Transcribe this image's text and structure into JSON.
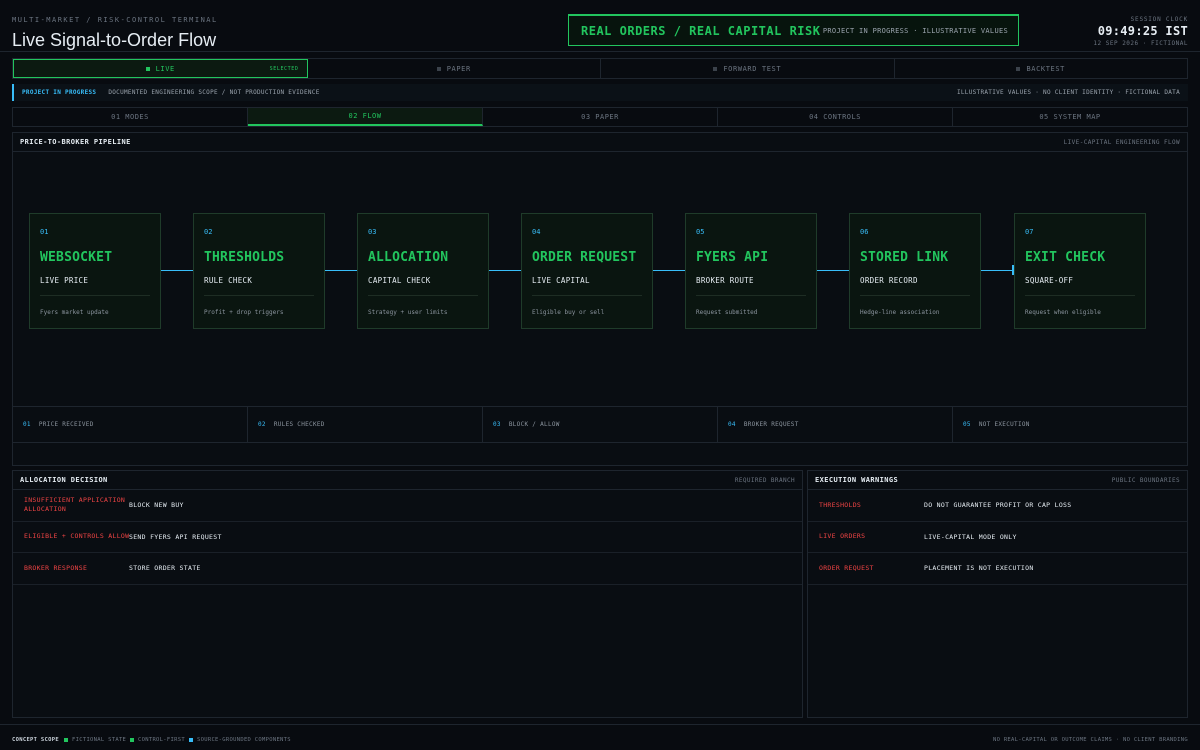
{
  "header": {
    "eyebrow": "MULTI-MARKET / RISK-CONTROL TERMINAL",
    "title": "Live Signal-to-Order Flow",
    "risk_banner": "REAL ORDERS / REAL CAPITAL RISK",
    "risk_sub": "PROJECT IN PROGRESS · ILLUSTRATIVE VALUES",
    "clock_label": "SESSION CLOCK",
    "clock": "09:49:25 IST",
    "clock_date": "12 SEP 2026 · FICTIONAL"
  },
  "modes": [
    {
      "label": "LIVE",
      "tag": "SELECTED",
      "active": true
    },
    {
      "label": "PAPER",
      "active": false
    },
    {
      "label": "FORWARD TEST",
      "active": false
    },
    {
      "label": "BACKTEST",
      "active": false
    }
  ],
  "scope": {
    "badge": "PROJECT IN PROGRESS",
    "text": "DOCUMENTED ENGINEERING SCOPE / NOT PRODUCTION EVIDENCE",
    "right": "ILLUSTRATIVE VALUES · NO CLIENT IDENTITY · FICTIONAL DATA"
  },
  "tabs": [
    {
      "label": "01 MODES",
      "active": false
    },
    {
      "label": "02 FLOW",
      "active": true
    },
    {
      "label": "03 PAPER",
      "active": false
    },
    {
      "label": "04 CONTROLS",
      "active": false
    },
    {
      "label": "05 SYSTEM MAP",
      "active": false
    }
  ],
  "pipeline": {
    "title": "PRICE-TO-BROKER PIPELINE",
    "subtitle": "LIVE-CAPITAL ENGINEERING FLOW",
    "nodes": [
      {
        "num": "01",
        "name": "WEBSOCKET",
        "sub": "LIVE PRICE",
        "desc": "Fyers market update"
      },
      {
        "num": "02",
        "name": "THRESHOLDS",
        "sub": "RULE CHECK",
        "desc": "Profit + drop triggers"
      },
      {
        "num": "03",
        "name": "ALLOCATION",
        "sub": "CAPITAL CHECK",
        "desc": "Strategy + user limits"
      },
      {
        "num": "04",
        "name": "ORDER REQUEST",
        "sub": "LIVE CAPITAL",
        "desc": "Eligible buy or sell"
      },
      {
        "num": "05",
        "name": "FYERS API",
        "sub": "BROKER ROUTE",
        "desc": "Request submitted"
      },
      {
        "num": "06",
        "name": "STORED LINK",
        "sub": "ORDER RECORD",
        "desc": "Hedge-line association"
      },
      {
        "num": "07",
        "name": "EXIT CHECK",
        "sub": "SQUARE-OFF",
        "desc": "Request when eligible"
      }
    ],
    "steps": [
      {
        "n": "01",
        "label": "PRICE RECEIVED"
      },
      {
        "n": "02",
        "label": "RULES CHECKED"
      },
      {
        "n": "03",
        "label": "BLOCK / ALLOW"
      },
      {
        "n": "04",
        "label": "BROKER REQUEST"
      },
      {
        "n": "05",
        "label": "NOT EXECUTION"
      }
    ]
  },
  "allocation": {
    "title": "ALLOCATION DECISION",
    "subtitle": "REQUIRED BRANCH",
    "rows": [
      {
        "k": "INSUFFICIENT APPLICATION ALLOCATION",
        "v": "BLOCK NEW BUY"
      },
      {
        "k": "ELIGIBLE + CONTROLS ALLOW",
        "v": "SEND FYERS API REQUEST"
      },
      {
        "k": "BROKER RESPONSE",
        "v": "STORE ORDER STATE"
      }
    ]
  },
  "warnings": {
    "title": "EXECUTION WARNINGS",
    "subtitle": "PUBLIC BOUNDARIES",
    "rows": [
      {
        "k": "THRESHOLDS",
        "v": "DO NOT GUARANTEE PROFIT OR CAP LOSS"
      },
      {
        "k": "LIVE ORDERS",
        "v": "LIVE-CAPITAL MODE ONLY"
      },
      {
        "k": "ORDER REQUEST",
        "v": "PLACEMENT IS NOT EXECUTION"
      }
    ]
  },
  "footer": {
    "label": "CONCEPT SCOPE",
    "legend": [
      {
        "label": "FICTIONAL STATE",
        "color": "#22c55e"
      },
      {
        "label": "CONTROL-FIRST",
        "color": "#22c55e"
      },
      {
        "label": "SOURCE-GROUNDED COMPONENTS",
        "color": "#38bdf8"
      }
    ],
    "right": "NO REAL-CAPITAL OR OUTCOME CLAIMS · NO CLIENT BRANDING"
  },
  "colors": {
    "accent_green": "#22c55e",
    "accent_blue": "#38bdf8",
    "warning_red": "#ef4444",
    "background": "#080b10"
  }
}
